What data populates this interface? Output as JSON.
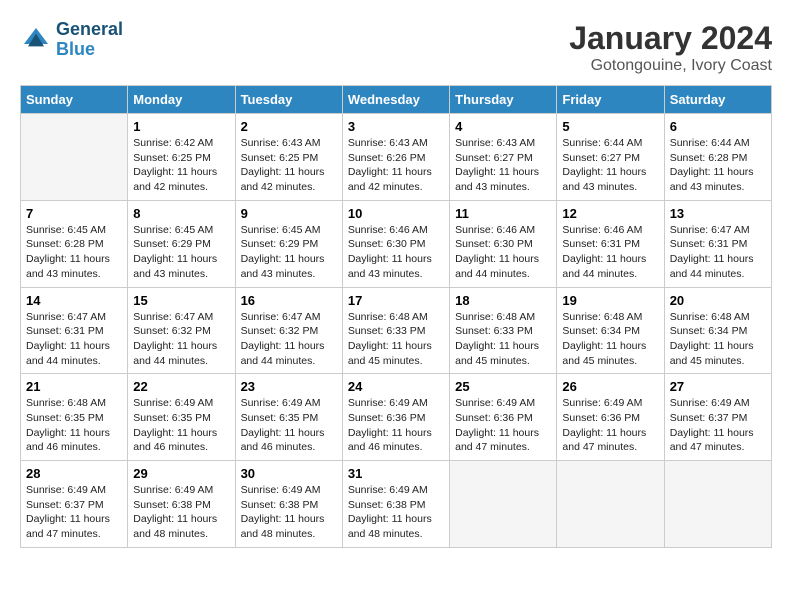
{
  "header": {
    "logo_line1": "General",
    "logo_line2": "Blue",
    "title": "January 2024",
    "subtitle": "Gotongouine, Ivory Coast"
  },
  "days_of_week": [
    "Sunday",
    "Monday",
    "Tuesday",
    "Wednesday",
    "Thursday",
    "Friday",
    "Saturday"
  ],
  "weeks": [
    [
      {
        "day": "",
        "sunrise": "",
        "sunset": "",
        "daylight": ""
      },
      {
        "day": "1",
        "sunrise": "Sunrise: 6:42 AM",
        "sunset": "Sunset: 6:25 PM",
        "daylight": "Daylight: 11 hours and 42 minutes."
      },
      {
        "day": "2",
        "sunrise": "Sunrise: 6:43 AM",
        "sunset": "Sunset: 6:25 PM",
        "daylight": "Daylight: 11 hours and 42 minutes."
      },
      {
        "day": "3",
        "sunrise": "Sunrise: 6:43 AM",
        "sunset": "Sunset: 6:26 PM",
        "daylight": "Daylight: 11 hours and 42 minutes."
      },
      {
        "day": "4",
        "sunrise": "Sunrise: 6:43 AM",
        "sunset": "Sunset: 6:27 PM",
        "daylight": "Daylight: 11 hours and 43 minutes."
      },
      {
        "day": "5",
        "sunrise": "Sunrise: 6:44 AM",
        "sunset": "Sunset: 6:27 PM",
        "daylight": "Daylight: 11 hours and 43 minutes."
      },
      {
        "day": "6",
        "sunrise": "Sunrise: 6:44 AM",
        "sunset": "Sunset: 6:28 PM",
        "daylight": "Daylight: 11 hours and 43 minutes."
      }
    ],
    [
      {
        "day": "7",
        "sunrise": "Sunrise: 6:45 AM",
        "sunset": "Sunset: 6:28 PM",
        "daylight": "Daylight: 11 hours and 43 minutes."
      },
      {
        "day": "8",
        "sunrise": "Sunrise: 6:45 AM",
        "sunset": "Sunset: 6:29 PM",
        "daylight": "Daylight: 11 hours and 43 minutes."
      },
      {
        "day": "9",
        "sunrise": "Sunrise: 6:45 AM",
        "sunset": "Sunset: 6:29 PM",
        "daylight": "Daylight: 11 hours and 43 minutes."
      },
      {
        "day": "10",
        "sunrise": "Sunrise: 6:46 AM",
        "sunset": "Sunset: 6:30 PM",
        "daylight": "Daylight: 11 hours and 43 minutes."
      },
      {
        "day": "11",
        "sunrise": "Sunrise: 6:46 AM",
        "sunset": "Sunset: 6:30 PM",
        "daylight": "Daylight: 11 hours and 44 minutes."
      },
      {
        "day": "12",
        "sunrise": "Sunrise: 6:46 AM",
        "sunset": "Sunset: 6:31 PM",
        "daylight": "Daylight: 11 hours and 44 minutes."
      },
      {
        "day": "13",
        "sunrise": "Sunrise: 6:47 AM",
        "sunset": "Sunset: 6:31 PM",
        "daylight": "Daylight: 11 hours and 44 minutes."
      }
    ],
    [
      {
        "day": "14",
        "sunrise": "Sunrise: 6:47 AM",
        "sunset": "Sunset: 6:31 PM",
        "daylight": "Daylight: 11 hours and 44 minutes."
      },
      {
        "day": "15",
        "sunrise": "Sunrise: 6:47 AM",
        "sunset": "Sunset: 6:32 PM",
        "daylight": "Daylight: 11 hours and 44 minutes."
      },
      {
        "day": "16",
        "sunrise": "Sunrise: 6:47 AM",
        "sunset": "Sunset: 6:32 PM",
        "daylight": "Daylight: 11 hours and 44 minutes."
      },
      {
        "day": "17",
        "sunrise": "Sunrise: 6:48 AM",
        "sunset": "Sunset: 6:33 PM",
        "daylight": "Daylight: 11 hours and 45 minutes."
      },
      {
        "day": "18",
        "sunrise": "Sunrise: 6:48 AM",
        "sunset": "Sunset: 6:33 PM",
        "daylight": "Daylight: 11 hours and 45 minutes."
      },
      {
        "day": "19",
        "sunrise": "Sunrise: 6:48 AM",
        "sunset": "Sunset: 6:34 PM",
        "daylight": "Daylight: 11 hours and 45 minutes."
      },
      {
        "day": "20",
        "sunrise": "Sunrise: 6:48 AM",
        "sunset": "Sunset: 6:34 PM",
        "daylight": "Daylight: 11 hours and 45 minutes."
      }
    ],
    [
      {
        "day": "21",
        "sunrise": "Sunrise: 6:48 AM",
        "sunset": "Sunset: 6:35 PM",
        "daylight": "Daylight: 11 hours and 46 minutes."
      },
      {
        "day": "22",
        "sunrise": "Sunrise: 6:49 AM",
        "sunset": "Sunset: 6:35 PM",
        "daylight": "Daylight: 11 hours and 46 minutes."
      },
      {
        "day": "23",
        "sunrise": "Sunrise: 6:49 AM",
        "sunset": "Sunset: 6:35 PM",
        "daylight": "Daylight: 11 hours and 46 minutes."
      },
      {
        "day": "24",
        "sunrise": "Sunrise: 6:49 AM",
        "sunset": "Sunset: 6:36 PM",
        "daylight": "Daylight: 11 hours and 46 minutes."
      },
      {
        "day": "25",
        "sunrise": "Sunrise: 6:49 AM",
        "sunset": "Sunset: 6:36 PM",
        "daylight": "Daylight: 11 hours and 47 minutes."
      },
      {
        "day": "26",
        "sunrise": "Sunrise: 6:49 AM",
        "sunset": "Sunset: 6:36 PM",
        "daylight": "Daylight: 11 hours and 47 minutes."
      },
      {
        "day": "27",
        "sunrise": "Sunrise: 6:49 AM",
        "sunset": "Sunset: 6:37 PM",
        "daylight": "Daylight: 11 hours and 47 minutes."
      }
    ],
    [
      {
        "day": "28",
        "sunrise": "Sunrise: 6:49 AM",
        "sunset": "Sunset: 6:37 PM",
        "daylight": "Daylight: 11 hours and 47 minutes."
      },
      {
        "day": "29",
        "sunrise": "Sunrise: 6:49 AM",
        "sunset": "Sunset: 6:38 PM",
        "daylight": "Daylight: 11 hours and 48 minutes."
      },
      {
        "day": "30",
        "sunrise": "Sunrise: 6:49 AM",
        "sunset": "Sunset: 6:38 PM",
        "daylight": "Daylight: 11 hours and 48 minutes."
      },
      {
        "day": "31",
        "sunrise": "Sunrise: 6:49 AM",
        "sunset": "Sunset: 6:38 PM",
        "daylight": "Daylight: 11 hours and 48 minutes."
      },
      {
        "day": "",
        "sunrise": "",
        "sunset": "",
        "daylight": ""
      },
      {
        "day": "",
        "sunrise": "",
        "sunset": "",
        "daylight": ""
      },
      {
        "day": "",
        "sunrise": "",
        "sunset": "",
        "daylight": ""
      }
    ]
  ]
}
